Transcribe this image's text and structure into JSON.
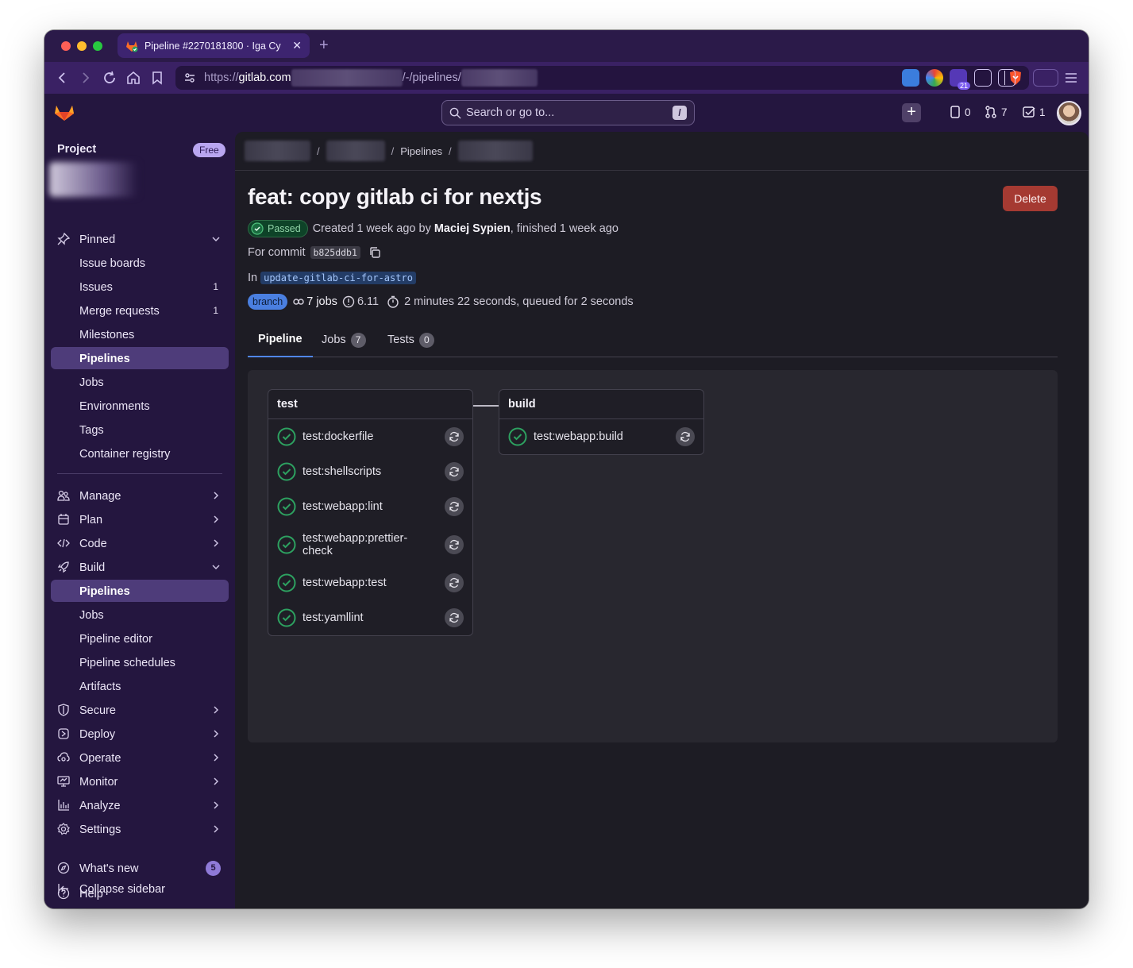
{
  "browser": {
    "tab_title": "Pipeline #2270181800 · Iga Cy",
    "tab_close": "✕",
    "new_tab": "+",
    "url_scheme": "https://",
    "url_host": "gitlab.com",
    "url_mid": "/-/pipelines/",
    "extension_badge": "21"
  },
  "topbar": {
    "search_placeholder": "Search or go to...",
    "search_shortcut": "/",
    "plus_label": "+",
    "issues_count": "0",
    "merge_requests_count": "7",
    "todos_count": "1"
  },
  "sidebar": {
    "heading": "Project",
    "plan_badge": "Free",
    "pinned": {
      "label": "Pinned",
      "items": [
        {
          "label": "Issue boards",
          "count": ""
        },
        {
          "label": "Issues",
          "count": "1"
        },
        {
          "label": "Merge requests",
          "count": "1"
        },
        {
          "label": "Milestones",
          "count": ""
        },
        {
          "label": "Pipelines",
          "count": ""
        },
        {
          "label": "Jobs",
          "count": ""
        },
        {
          "label": "Environments",
          "count": ""
        },
        {
          "label": "Tags",
          "count": ""
        },
        {
          "label": "Container registry",
          "count": ""
        }
      ]
    },
    "groups": {
      "manage": "Manage",
      "plan": "Plan",
      "code": "Code",
      "build": "Build",
      "secure": "Secure",
      "deploy": "Deploy",
      "operate": "Operate",
      "monitor": "Monitor",
      "analyze": "Analyze",
      "settings": "Settings"
    },
    "build_items": [
      "Pipelines",
      "Jobs",
      "Pipeline editor",
      "Pipeline schedules",
      "Artifacts"
    ],
    "footer": {
      "whats_new": "What's new",
      "whats_new_count": "5",
      "help": "Help",
      "collapse": "Collapse sidebar"
    }
  },
  "breadcrumb": {
    "sep": "/",
    "pipelines": "Pipelines"
  },
  "pipeline": {
    "title": "feat: copy gitlab ci for nextjs",
    "delete_label": "Delete",
    "status": "Passed",
    "created_text": "Created 1 week ago by",
    "author": "Maciej Sypien",
    "finished_text": ", finished 1 week ago",
    "for_commit": "For commit",
    "sha": "b825ddb1",
    "in_label": "In",
    "branch_ref": "update-gitlab-ci-for-astro",
    "branch_badge": "branch",
    "jobs_count": "7 jobs",
    "compute": "6.11",
    "duration": "2 minutes 22 seconds, queued for 2 seconds"
  },
  "tabs": [
    {
      "label": "Pipeline",
      "count": ""
    },
    {
      "label": "Jobs",
      "count": "7"
    },
    {
      "label": "Tests",
      "count": "0"
    }
  ],
  "stages": [
    {
      "name": "test",
      "jobs": [
        "test:dockerfile",
        "test:shellscripts",
        "test:webapp:lint",
        "test:webapp:prettier-check",
        "test:webapp:test",
        "test:yamllint"
      ]
    },
    {
      "name": "build",
      "jobs": [
        "test:webapp:build"
      ]
    }
  ],
  "colors": {
    "chrome_purple": "#24163f",
    "success_green": "#2da160",
    "delete_red": "#a53a32",
    "accent_blue": "#5086e8"
  }
}
